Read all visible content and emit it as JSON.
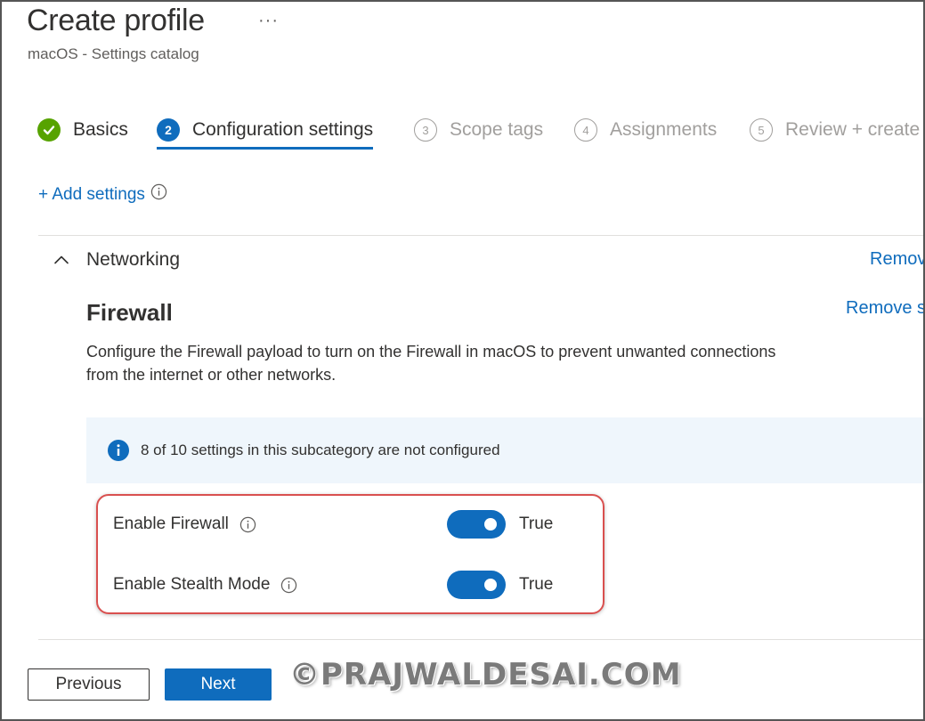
{
  "header": {
    "title": "Create profile",
    "more": "···",
    "subtitle": "macOS - Settings catalog"
  },
  "wizard": {
    "steps": [
      {
        "number": "",
        "label": "Basics",
        "state": "complete"
      },
      {
        "number": "2",
        "label": "Configuration settings",
        "state": "current"
      },
      {
        "number": "3",
        "label": "Scope tags",
        "state": "upcoming"
      },
      {
        "number": "4",
        "label": "Assignments",
        "state": "upcoming"
      },
      {
        "number": "5",
        "label": "Review + create",
        "state": "upcoming"
      }
    ]
  },
  "add_settings": {
    "label": "+ Add settings"
  },
  "category": {
    "title": "Networking",
    "remove_label": "Remove category"
  },
  "subcategory": {
    "title": "Firewall",
    "remove_label": "Remove subcategory",
    "description": "Configure the Firewall payload to turn on the Firewall in macOS to prevent unwanted connections from the internet or other networks.",
    "banner": "8 of 10 settings in this subcategory are not configured"
  },
  "settings": [
    {
      "label": "Enable Firewall",
      "value": "True",
      "enabled": true
    },
    {
      "label": "Enable Stealth Mode",
      "value": "True",
      "enabled": true
    }
  ],
  "footer": {
    "previous_label": "Previous",
    "next_label": "Next"
  },
  "watermark": "©PRAJWALDESAI.COM",
  "colors": {
    "accent": "#0f6cbd",
    "success": "#57a300",
    "highlight": "#d9504f",
    "banner_bg": "#eff6fc"
  }
}
